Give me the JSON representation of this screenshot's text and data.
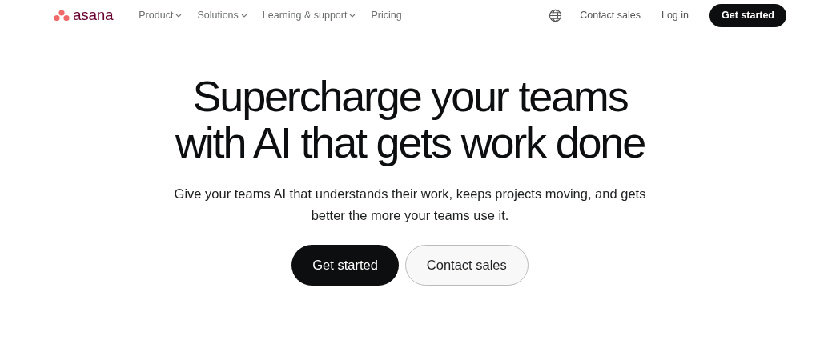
{
  "header": {
    "logo": "asana",
    "nav": [
      {
        "label": "Product",
        "dropdown": true
      },
      {
        "label": "Solutions",
        "dropdown": true
      },
      {
        "label": "Learning & support",
        "dropdown": true
      },
      {
        "label": "Pricing",
        "dropdown": false
      }
    ],
    "actions": [
      {
        "kind": "link",
        "label": "Contact sales"
      },
      {
        "kind": "link",
        "label": "Log in"
      },
      {
        "kind": "primary",
        "label": "Get started"
      }
    ]
  },
  "hero": {
    "headline": "Supercharge your teams with AI that gets work done",
    "subtitle": "Give your teams AI that understands their work, keeps projects moving, and gets better the more your teams use it.",
    "buttons": [
      {
        "kind": "primary",
        "label": "Get started"
      },
      {
        "kind": "secondary",
        "label": "Contact sales"
      }
    ]
  }
}
